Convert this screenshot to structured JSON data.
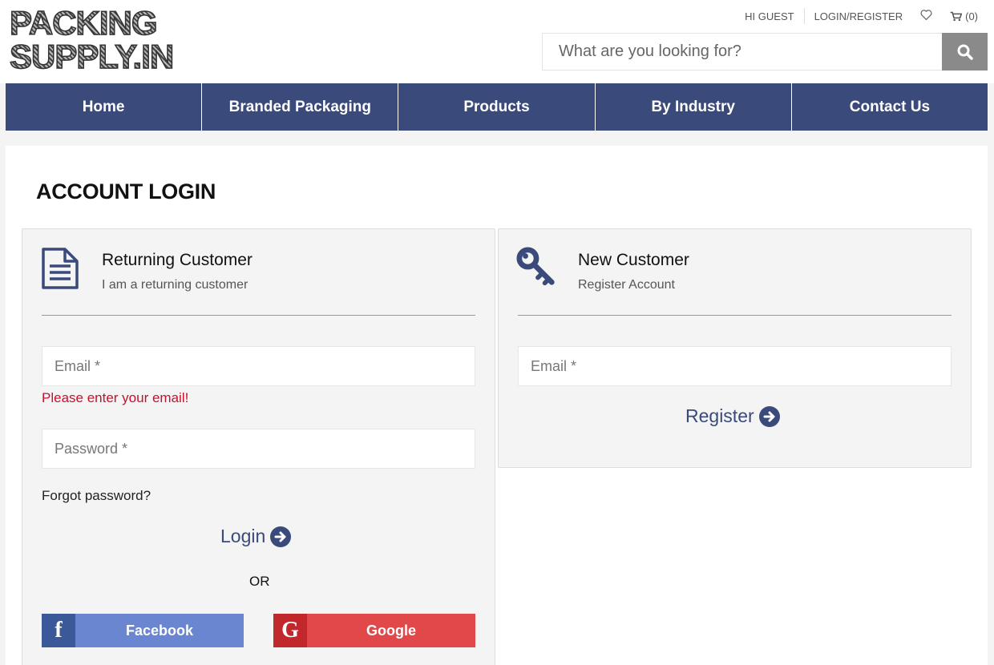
{
  "logo": {
    "line1": "PACKING",
    "line2": "SUPPLY.IN"
  },
  "topbar": {
    "greeting": "HI GUEST",
    "login_register": "LOGIN/REGISTER",
    "wishlist_icon": "heart-icon",
    "cart_icon": "cart-icon",
    "cart_count": "(0)"
  },
  "search": {
    "placeholder": "What are you looking for?",
    "value": "",
    "icon": "search-icon"
  },
  "nav": {
    "items": [
      {
        "label": "Home"
      },
      {
        "label": "Branded Packaging"
      },
      {
        "label": "Products"
      },
      {
        "label": "By Industry"
      },
      {
        "label": "Contact Us"
      }
    ]
  },
  "colors": {
    "brand": "#3a4a7b",
    "error": "#c8102e",
    "facebook": "#6b86d0",
    "google": "#e0484a"
  },
  "page": {
    "title": "ACCOUNT LOGIN"
  },
  "returning": {
    "icon": "document-icon",
    "title": "Returning Customer",
    "subtitle": "I am a returning customer",
    "email_placeholder": "Email *",
    "email_error": "Please enter your email!",
    "password_placeholder": "Password *",
    "forgot": "Forgot password?",
    "login_label": "Login",
    "or": "OR",
    "facebook": {
      "icon_char": "f",
      "label": "Facebook"
    },
    "google": {
      "icon_char": "G",
      "label": "Google"
    }
  },
  "new_customer": {
    "icon": "key-icon",
    "title": "New Customer",
    "subtitle": "Register Account",
    "email_placeholder": "Email *",
    "register_label": "Register"
  }
}
